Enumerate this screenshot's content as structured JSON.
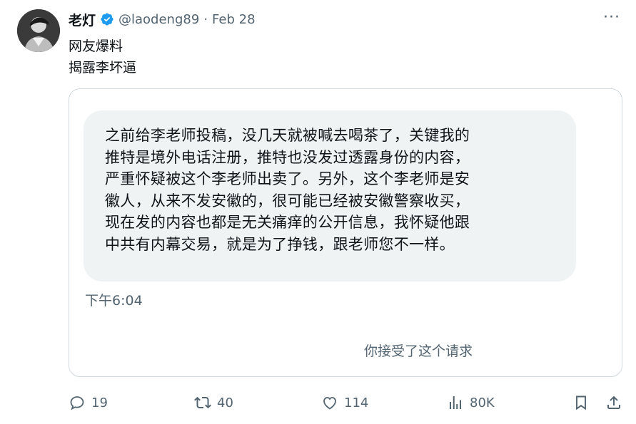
{
  "tweet": {
    "author_name": "老灯",
    "handle": "@laodeng89",
    "separator": "·",
    "date": "Feb 28",
    "more_label": "···",
    "text_line1": "网友爆料",
    "text_line2": "揭露李坏逼"
  },
  "card": {
    "message_lines": [
      "之前给李老师投稿，没几天就被喊去喝茶了，关键我的",
      "推特是境外电话注册，推特也没发过透露身份的内容，",
      "严重怀疑被这个李老师出卖了。另外，这个李老师是安",
      "徽人，从来不发安徽的，很可能已经被安徽警察收买，",
      "现在发的内容也都是无关痛痒的公开信息，我怀疑他跟",
      "中共有内幕交易，就是为了挣钱，跟老师您不一样。"
    ],
    "message_time": "下午6:04",
    "accepted_text": "你接受了这个请求"
  },
  "actions": {
    "reply_count": "19",
    "retweet_count": "40",
    "like_count": "114",
    "views_count": "80K"
  },
  "colors": {
    "verified": "#1d9bf0",
    "muted": "#536471",
    "border": "#cfd9de",
    "bubble": "#eff3f4"
  },
  "icons": [
    "verified-badge-icon",
    "more-icon",
    "reply-icon",
    "retweet-icon",
    "like-icon",
    "views-icon",
    "bookmark-icon",
    "share-icon"
  ]
}
